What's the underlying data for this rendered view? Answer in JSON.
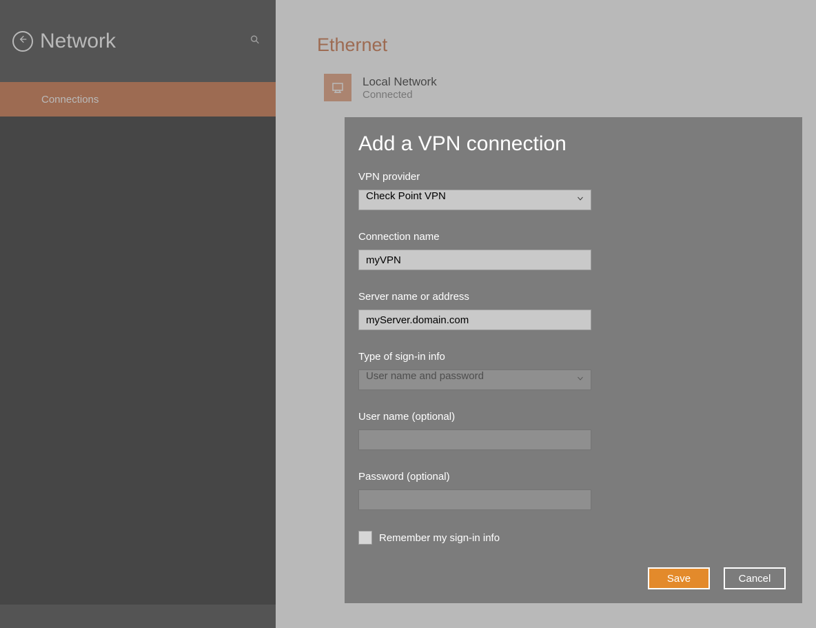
{
  "sidebar": {
    "title": "Network",
    "items": [
      {
        "label": "Connections",
        "active": true
      }
    ]
  },
  "main": {
    "title": "Ethernet",
    "connection": {
      "name": "Local Network",
      "status": "Connected"
    }
  },
  "dialog": {
    "title": "Add a VPN connection",
    "fields": {
      "vpn_provider": {
        "label": "VPN provider",
        "value": "Check Point VPN"
      },
      "connection_name": {
        "label": "Connection name",
        "value": "myVPN"
      },
      "server": {
        "label": "Server name or address",
        "value": "myServer.domain.com"
      },
      "signin_type": {
        "label": "Type of sign-in info",
        "value": "User name and password"
      },
      "username": {
        "label": "User name (optional)",
        "value": ""
      },
      "password": {
        "label": "Password (optional)",
        "value": ""
      },
      "remember": {
        "label": "Remember my sign-in info",
        "checked": false
      }
    },
    "buttons": {
      "save": "Save",
      "cancel": "Cancel"
    }
  }
}
